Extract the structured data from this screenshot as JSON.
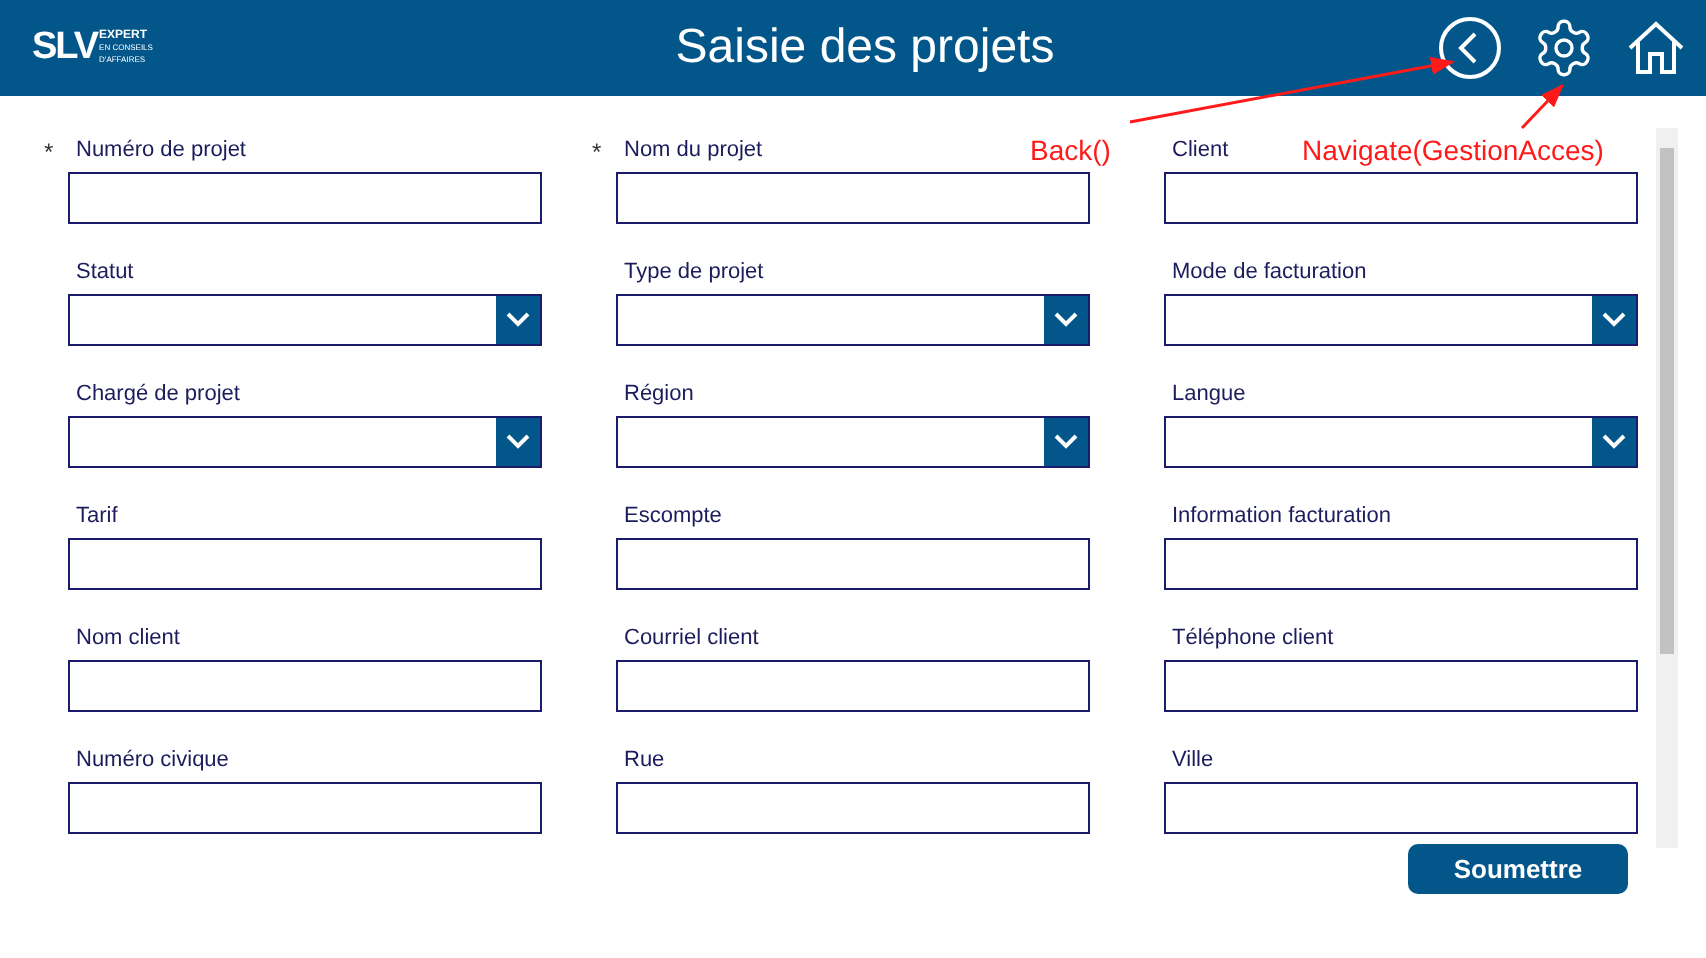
{
  "header": {
    "logo": {
      "letters": "SLV",
      "tagline": [
        "EXPERT",
        "EN CONSEILS",
        "D'AFFAIRES"
      ]
    },
    "title": "Saisie des projets"
  },
  "fields": [
    {
      "label": "Numéro de projet",
      "kind": "text",
      "required": true
    },
    {
      "label": "Nom du projet",
      "kind": "text",
      "required": true
    },
    {
      "label": "Client",
      "kind": "text",
      "required": false
    },
    {
      "label": "Statut",
      "kind": "dropdown",
      "required": false
    },
    {
      "label": "Type de projet",
      "kind": "dropdown",
      "required": false
    },
    {
      "label": "Mode de facturation",
      "kind": "dropdown",
      "required": false
    },
    {
      "label": "Chargé de projet",
      "kind": "dropdown",
      "required": false
    },
    {
      "label": "Région",
      "kind": "dropdown",
      "required": false
    },
    {
      "label": "Langue",
      "kind": "dropdown",
      "required": false
    },
    {
      "label": "Tarif",
      "kind": "text",
      "required": false
    },
    {
      "label": "Escompte",
      "kind": "text",
      "required": false
    },
    {
      "label": "Information facturation",
      "kind": "text",
      "required": false
    },
    {
      "label": "Nom client",
      "kind": "text",
      "required": false
    },
    {
      "label": "Courriel client",
      "kind": "text",
      "required": false
    },
    {
      "label": "Téléphone client",
      "kind": "text",
      "required": false
    },
    {
      "label": "Numéro civique",
      "kind": "text",
      "required": false
    },
    {
      "label": "Rue",
      "kind": "text",
      "required": false
    },
    {
      "label": "Ville",
      "kind": "text",
      "required": false
    }
  ],
  "submit": "Soumettre",
  "annotations": [
    "Back()",
    "Navigate(GestionAcces)"
  ],
  "required_mark": "*"
}
